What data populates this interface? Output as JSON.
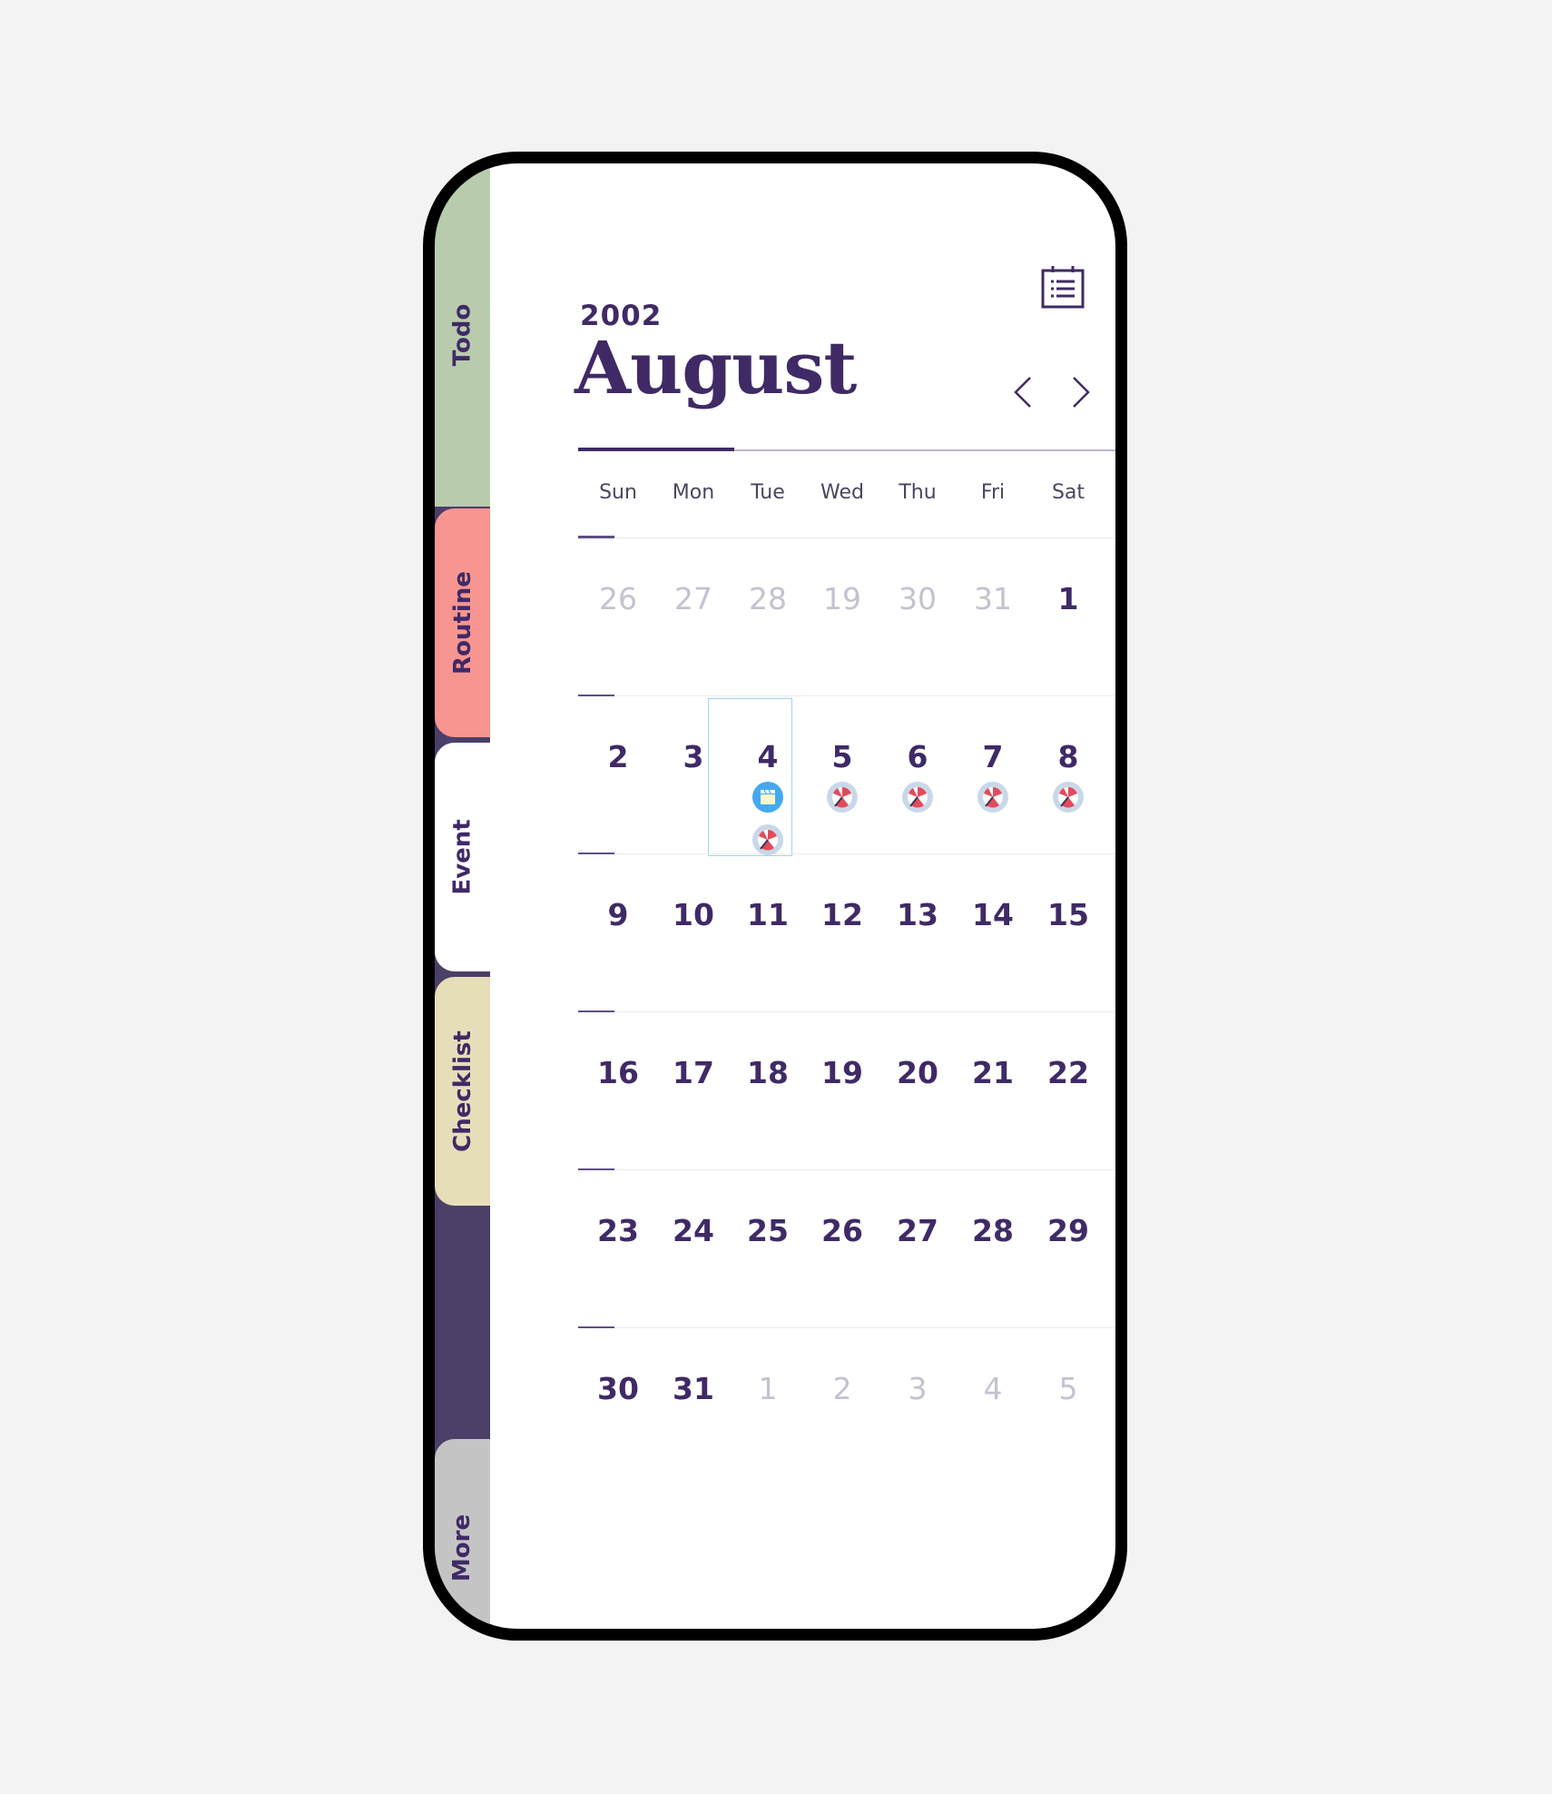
{
  "tabs": [
    {
      "label": "Todo",
      "color": "#b9cbad"
    },
    {
      "label": "Routine",
      "color": "#f79590"
    },
    {
      "label": "Event",
      "color": "#ffffff"
    },
    {
      "label": "Checklist",
      "color": "#e6deb9"
    },
    {
      "label": "More",
      "color": "#c4c4c4"
    }
  ],
  "header": {
    "year": "2002",
    "month": "August"
  },
  "weekdays": [
    "Sun",
    "Mon",
    "Tue",
    "Wed",
    "Thu",
    "Fri",
    "Sat"
  ],
  "weeks": [
    [
      "26",
      "27",
      "28",
      "19",
      "30",
      "31",
      "1"
    ],
    [
      "2",
      "3",
      "4",
      "5",
      "6",
      "7",
      "8"
    ],
    [
      "9",
      "10",
      "11",
      "12",
      "13",
      "14",
      "15"
    ],
    [
      "16",
      "17",
      "18",
      "19",
      "20",
      "21",
      "22"
    ],
    [
      "23",
      "24",
      "25",
      "26",
      "27",
      "28",
      "29"
    ],
    [
      "30",
      "31",
      "1",
      "2",
      "3",
      "4",
      "5"
    ]
  ],
  "selected_day": "4",
  "events": {
    "4": [
      "clapperboard-icon",
      "beach-umbrella-icon"
    ],
    "5": [
      "beach-umbrella-icon"
    ],
    "6": [
      "beach-umbrella-icon"
    ],
    "7": [
      "beach-umbrella-icon"
    ],
    "8": [
      "beach-umbrella-icon"
    ]
  },
  "colors": {
    "primary": "#3f2a66",
    "sidebar": "#4b3f68",
    "muted_day": "#c5c1cf",
    "selection_border": "#9fd3ee"
  }
}
